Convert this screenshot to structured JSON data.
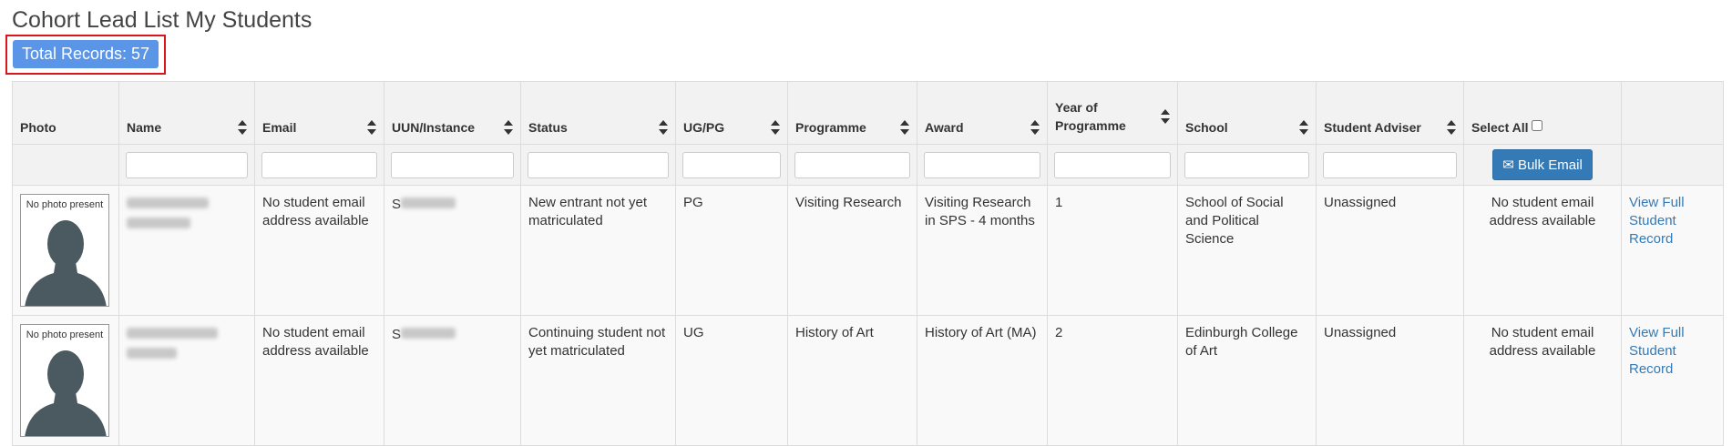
{
  "page": {
    "title": "Cohort Lead List My Students"
  },
  "summary": {
    "total_records_label": "Total Records: 57"
  },
  "table": {
    "headers": {
      "photo": "Photo",
      "name": "Name",
      "email": "Email",
      "uun": "UUN/Instance",
      "status": "Status",
      "ugpg": "UG/PG",
      "programme": "Programme",
      "award": "Award",
      "year": "Year of Programme",
      "school": "School",
      "adviser": "Student Adviser",
      "select_all": "Select All"
    },
    "bulk_email_label": "Bulk Email",
    "rows": [
      {
        "photo_label": "No photo present",
        "uun_prefix": "S",
        "email": "No student email address available",
        "status": "New entrant not yet matriculated",
        "ugpg": "PG",
        "programme": "Visiting Research",
        "award": "Visiting Research in SPS - 4 months",
        "year": "1",
        "school": "School of Social and Political Science",
        "adviser": "Unassigned",
        "bulk_status": "No student email address available",
        "link": "View Full Student Record"
      },
      {
        "photo_label": "No photo present",
        "uun_prefix": "S",
        "email": "No student email address available",
        "status": "Continuing student not yet matriculated",
        "ugpg": "UG",
        "programme": "History of Art",
        "award": "History of Art (MA)",
        "year": "2",
        "school": "Edinburgh College of Art",
        "adviser": "Unassigned",
        "bulk_status": "No student email address available",
        "link": "View Full Student Record"
      }
    ]
  },
  "colors": {
    "badge": "#5b95e8",
    "highlight_frame": "#d9161c",
    "button": "#337ab7"
  }
}
